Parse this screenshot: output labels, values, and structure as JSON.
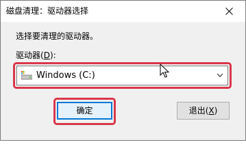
{
  "window": {
    "title": "磁盘清理：驱动器选择",
    "close_icon": "close-icon"
  },
  "prompt_text": "选择要清理的驱动器。",
  "drive_label": {
    "prefix": "驱动器(",
    "accel": "D",
    "suffix": "):"
  },
  "drive_select": {
    "selected_value": "Windows (C:)",
    "icon": "drive-icon"
  },
  "buttons": {
    "ok_label": "确定",
    "exit_prefix": "退出(",
    "exit_accel": "X",
    "exit_suffix": ")"
  },
  "annotation_color": "#d9374b",
  "accent_color": "#0078d7"
}
